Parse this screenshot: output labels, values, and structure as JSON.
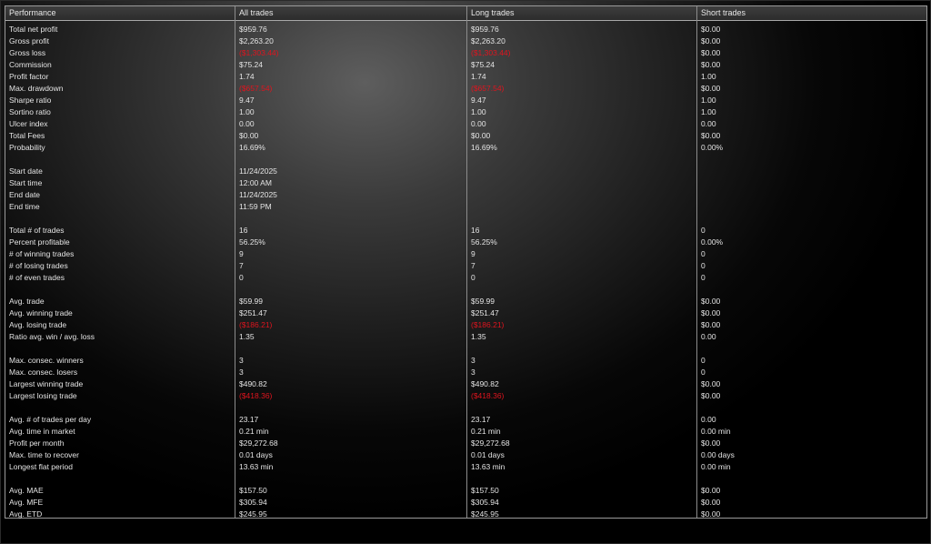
{
  "headers": [
    "Performance",
    "All trades",
    "Long trades",
    "Short trades"
  ],
  "rows": [
    {
      "label": "Total net profit",
      "all": "$959.76",
      "long": "$959.76",
      "short": "$0.00"
    },
    {
      "label": "Gross profit",
      "all": "$2,263.20",
      "long": "$2,263.20",
      "short": "$0.00"
    },
    {
      "label": "Gross loss",
      "all": "($1,303.44)",
      "long": "($1,303.44)",
      "short": "$0.00",
      "negative": true
    },
    {
      "label": "Commission",
      "all": "$75.24",
      "long": "$75.24",
      "short": "$0.00"
    },
    {
      "label": "Profit factor",
      "all": "1.74",
      "long": "1.74",
      "short": "1.00"
    },
    {
      "label": "Max. drawdown",
      "all": "($657.54)",
      "long": "($657.54)",
      "short": "$0.00",
      "negative": true
    },
    {
      "label": "Sharpe ratio",
      "all": "9.47",
      "long": "9.47",
      "short": "1.00"
    },
    {
      "label": "Sortino ratio",
      "all": "1.00",
      "long": "1.00",
      "short": "1.00"
    },
    {
      "label": "Ulcer index",
      "all": "0.00",
      "long": "0.00",
      "short": "0.00"
    },
    {
      "label": "Total Fees",
      "all": "$0.00",
      "long": "$0.00",
      "short": "$0.00"
    },
    {
      "label": "Probability",
      "all": "16.69%",
      "long": "16.69%",
      "short": "0.00%"
    },
    {
      "label": "",
      "all": "",
      "long": "",
      "short": ""
    },
    {
      "label": "Start date",
      "all": "11/24/2025",
      "long": "",
      "short": ""
    },
    {
      "label": "Start time",
      "all": "12:00 AM",
      "long": "",
      "short": ""
    },
    {
      "label": "End date",
      "all": "11/24/2025",
      "long": "",
      "short": ""
    },
    {
      "label": "End time",
      "all": "11:59 PM",
      "long": "",
      "short": ""
    },
    {
      "label": "",
      "all": "",
      "long": "",
      "short": ""
    },
    {
      "label": "Total # of trades",
      "all": "16",
      "long": "16",
      "short": "0"
    },
    {
      "label": "Percent profitable",
      "all": "56.25%",
      "long": "56.25%",
      "short": "0.00%"
    },
    {
      "label": "# of winning trades",
      "all": "9",
      "long": "9",
      "short": "0"
    },
    {
      "label": "# of losing trades",
      "all": "7",
      "long": "7",
      "short": "0"
    },
    {
      "label": "# of even trades",
      "all": "0",
      "long": "0",
      "short": "0"
    },
    {
      "label": "",
      "all": "",
      "long": "",
      "short": ""
    },
    {
      "label": "Avg. trade",
      "all": "$59.99",
      "long": "$59.99",
      "short": "$0.00"
    },
    {
      "label": "Avg. winning trade",
      "all": "$251.47",
      "long": "$251.47",
      "short": "$0.00"
    },
    {
      "label": "Avg. losing trade",
      "all": "($186.21)",
      "long": "($186.21)",
      "short": "$0.00",
      "negative": true
    },
    {
      "label": "Ratio avg. win / avg. loss",
      "all": "1.35",
      "long": "1.35",
      "short": "0.00"
    },
    {
      "label": "",
      "all": "",
      "long": "",
      "short": ""
    },
    {
      "label": "Max. consec. winners",
      "all": "3",
      "long": "3",
      "short": "0"
    },
    {
      "label": "Max. consec. losers",
      "all": "3",
      "long": "3",
      "short": "0"
    },
    {
      "label": "Largest winning trade",
      "all": "$490.82",
      "long": "$490.82",
      "short": "$0.00"
    },
    {
      "label": "Largest losing trade",
      "all": "($418.36)",
      "long": "($418.36)",
      "short": "$0.00",
      "negative": true
    },
    {
      "label": "",
      "all": "",
      "long": "",
      "short": ""
    },
    {
      "label": "Avg. # of trades per day",
      "all": "23.17",
      "long": "23.17",
      "short": "0.00"
    },
    {
      "label": "Avg. time in market",
      "all": "0.21 min",
      "long": "0.21 min",
      "short": "0.00 min"
    },
    {
      "label": "Profit per month",
      "all": "$29,272.68",
      "long": "$29,272.68",
      "short": "$0.00"
    },
    {
      "label": "Max. time to recover",
      "all": "0.01 days",
      "long": "0.01 days",
      "short": "0.00 days"
    },
    {
      "label": "Longest flat period",
      "all": "13.63 min",
      "long": "13.63 min",
      "short": "0.00 min"
    },
    {
      "label": "",
      "all": "",
      "long": "",
      "short": ""
    },
    {
      "label": "Avg. MAE",
      "all": "$157.50",
      "long": "$157.50",
      "short": "$0.00"
    },
    {
      "label": "Avg. MFE",
      "all": "$305.94",
      "long": "$305.94",
      "short": "$0.00"
    },
    {
      "label": "Avg. ETD",
      "all": "$245.95",
      "long": "$245.95",
      "short": "$0.00"
    }
  ],
  "colors": {
    "text": "#e4e4e4",
    "negative": "#e0141e",
    "gridline": "#8c8c8c"
  }
}
